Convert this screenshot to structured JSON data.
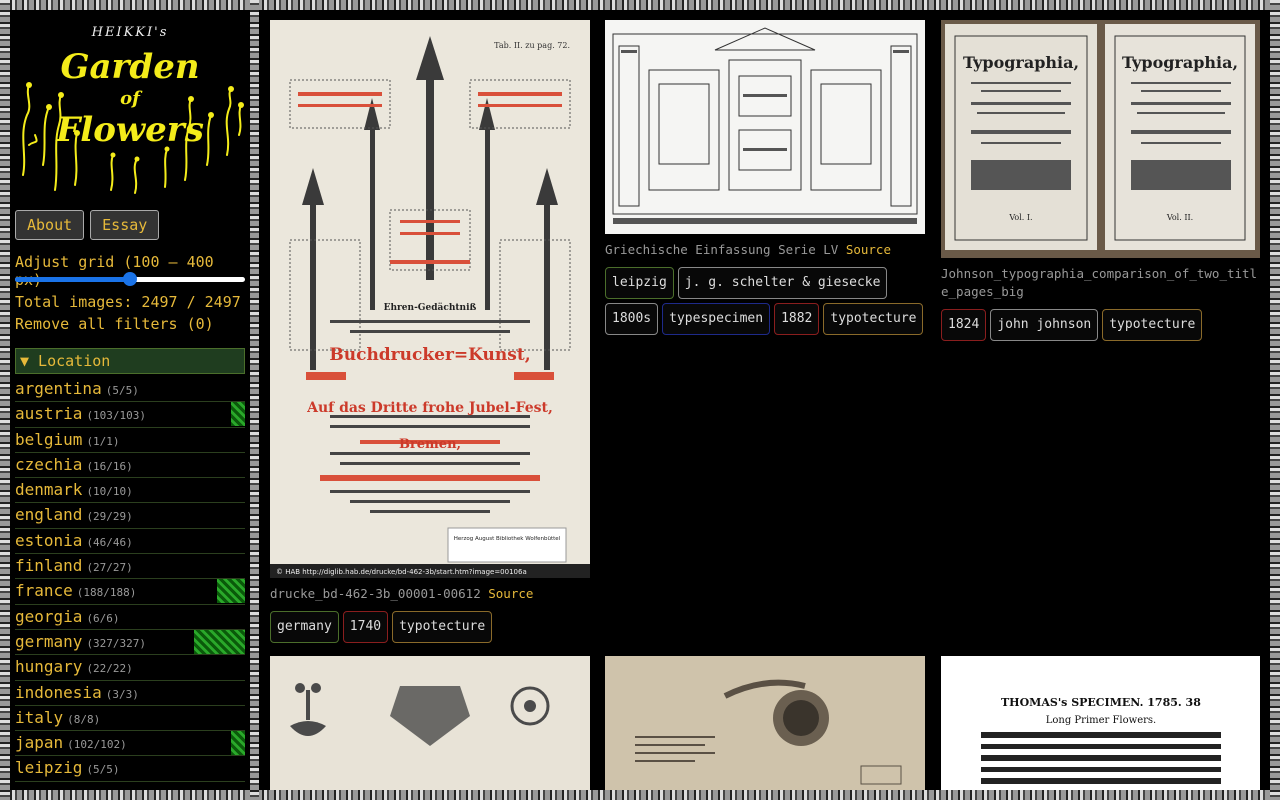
{
  "logo": {
    "top": "HEIKKI's",
    "line1": "Garden",
    "line2": "of",
    "line3": "Flowers"
  },
  "nav": {
    "about": "About",
    "essay": "Essay"
  },
  "grid": {
    "label": "Adjust grid (100 – 400 px)",
    "value": 250,
    "min": 100,
    "max": 400
  },
  "total_text": "Total images: 2497 / 2497",
  "remove_filters": "Remove all filters (0)",
  "location_header": "▼ Location",
  "locations": [
    {
      "name": "argentina",
      "count": "(5/5)",
      "share": 0
    },
    {
      "name": "austria",
      "count": "(103/103)",
      "share": 0.06
    },
    {
      "name": "belgium",
      "count": "(1/1)",
      "share": 0
    },
    {
      "name": "czechia",
      "count": "(16/16)",
      "share": 0
    },
    {
      "name": "denmark",
      "count": "(10/10)",
      "share": 0
    },
    {
      "name": "england",
      "count": "(29/29)",
      "share": 0
    },
    {
      "name": "estonia",
      "count": "(46/46)",
      "share": 0
    },
    {
      "name": "finland",
      "count": "(27/27)",
      "share": 0
    },
    {
      "name": "france",
      "count": "(188/188)",
      "share": 0.12
    },
    {
      "name": "georgia",
      "count": "(6/6)",
      "share": 0
    },
    {
      "name": "germany",
      "count": "(327/327)",
      "share": 0.22
    },
    {
      "name": "hungary",
      "count": "(22/22)",
      "share": 0
    },
    {
      "name": "indonesia",
      "count": "(3/3)",
      "share": 0
    },
    {
      "name": "italy",
      "count": "(8/8)",
      "share": 0
    },
    {
      "name": "japan",
      "count": "(102/102)",
      "share": 0.06
    },
    {
      "name": "leipzig",
      "count": "(5/5)",
      "share": 0
    }
  ],
  "images": [
    {
      "title": "drucke_bd-462-3b_00001-00612",
      "source": "Source",
      "tags": [
        {
          "label": "germany",
          "kind": "loc"
        },
        {
          "label": "1740",
          "kind": "year"
        },
        {
          "label": "typotecture",
          "kind": "type"
        }
      ],
      "inner_text": {
        "heading": "Tab. II. zu pag. 72.",
        "big": "Buchdrucker=Kunst,",
        "sub": "Auf das Dritte frohe Jubel-Fest,",
        "place": "Bremen,",
        "footer": "© HAB http://diglib.hab.de/drucke/bd-462-3b/start.htm?image=00106a",
        "label": "Herzog August Bibliothek Wolfenbüttel"
      }
    },
    {
      "title": "Griechische Einfassung Serie LV",
      "source": "Source",
      "tags": [
        {
          "label": "leipzig",
          "kind": "loc"
        },
        {
          "label": "j. g. schelter & giesecke",
          "kind": "person"
        },
        {
          "label": "1800s",
          "kind": "person"
        },
        {
          "label": "typespecimen",
          "kind": "type2"
        },
        {
          "label": "1882",
          "kind": "year"
        },
        {
          "label": "typotecture",
          "kind": "type"
        }
      ]
    },
    {
      "title": "Johnson_typographia_comparison_of_two_title_pages_big",
      "source": "",
      "tags": [
        {
          "label": "1824",
          "kind": "year"
        },
        {
          "label": "john johnson",
          "kind": "person"
        },
        {
          "label": "typotecture",
          "kind": "type"
        }
      ],
      "inner_text": {
        "title": "Typographia,",
        "vol1": "Vol. I.",
        "vol2": "Vol. II."
      }
    },
    {
      "title": "",
      "tags": []
    },
    {
      "title": "",
      "tags": []
    },
    {
      "title": "",
      "tags": [],
      "inner_text": {
        "heading": "THOMAS's SPECIMEN.  1785.      38",
        "sub": "Long Primer Flowers."
      }
    }
  ]
}
